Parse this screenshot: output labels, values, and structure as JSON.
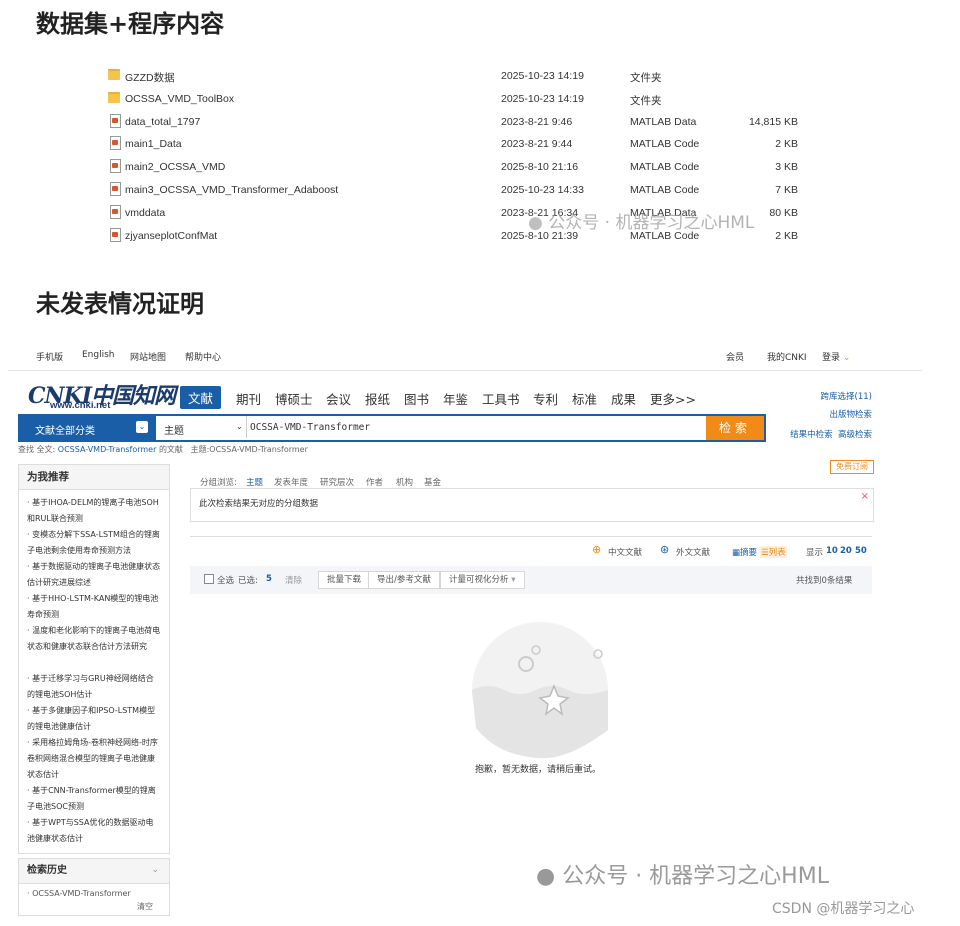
{
  "section1_title": "数据集+程序内容",
  "section2_title": "未发表情况证明",
  "files": [
    {
      "icon": "folder-icon",
      "name": "GZZD数据",
      "date": "2025-10-23 14:19",
      "type": "文件夹",
      "size": ""
    },
    {
      "icon": "folder-icon",
      "name": "OCSSA_VMD_ToolBox",
      "date": "2025-10-23 14:19",
      "type": "文件夹",
      "size": ""
    },
    {
      "icon": "matlab-file-icon",
      "name": "data_total_1797",
      "date": "2023-8-21 9:46",
      "type": "MATLAB Data",
      "size": "14,815 KB"
    },
    {
      "icon": "matlab-file-icon",
      "name": "main1_Data",
      "date": "2023-8-21 9:44",
      "type": "MATLAB Code",
      "size": "2 KB"
    },
    {
      "icon": "matlab-file-icon",
      "name": "main2_OCSSA_VMD",
      "date": "2025-8-10 21:16",
      "type": "MATLAB Code",
      "size": "3 KB"
    },
    {
      "icon": "matlab-file-icon",
      "name": "main3_OCSSA_VMD_Transformer_Adaboost",
      "date": "2025-10-23 14:33",
      "type": "MATLAB Code",
      "size": "7 KB"
    },
    {
      "icon": "matlab-file-icon",
      "name": "vmddata",
      "date": "2023-8-21 16:34",
      "type": "MATLAB Data",
      "size": "80 KB"
    },
    {
      "icon": "matlab-file-icon",
      "name": "zjyanseplotConfMat",
      "date": "2025-8-10 21:39",
      "type": "MATLAB Code",
      "size": "2 KB"
    }
  ],
  "watermark_small": "公众号 · 机器学习之心HML",
  "cnki": {
    "topbar": {
      "mobile": "手机版",
      "english": "English",
      "sitemap": "网站地图",
      "help": "帮助中心",
      "member": "会员",
      "my_cnki": "我的CNKI",
      "login": "登录"
    },
    "logo_text": "CNKI中国知网",
    "logo_url": "www.cnki.net",
    "nav": [
      "文献",
      "期刊",
      "博硕士",
      "会议",
      "报纸",
      "图书",
      "年鉴",
      "工具书",
      "专利",
      "标准",
      "成果",
      "更多>>"
    ],
    "side_links": {
      "cross_db": "跨库选择(11)",
      "publication_search": "出版物检索",
      "search_in_results": "结果中检索",
      "advanced_search": "高级检索"
    },
    "search": {
      "category": "文献全部分类",
      "field": "主题",
      "query": "OCSSA-VMD-Transformer",
      "button": "检索"
    },
    "crumb": {
      "prefix": "查找 全文:",
      "query": "OCSSA-VMD-Transformer",
      "suffix": "的文献",
      "subject": "主题:OCSSA-VMD-Transformer"
    },
    "free_subscribe": "免费订阅",
    "recommend_title": "为我推荐",
    "recommend": [
      "基于IHOA-DELM的锂离子电池SOH和RUL联合预测",
      "变模态分解下SSA-LSTM组合的锂离子电池剩余使用寿命预测方法",
      "基于数据驱动的锂离子电池健康状态估计研究进展综述",
      "基于HHO-LSTM-KAN模型的锂电池寿命预测",
      "温度和老化影响下的锂离子电池荷电状态和健康状态联合估计方法研究",
      "基于迁移学习与GRU神经网络结合的锂电池SOH估计",
      "基于多健康因子和IPSO-LSTM模型的锂电池健康估计",
      "采用格拉姆角场-卷积神经网络-时序卷积网络混合模型的锂离子电池健康状态估计",
      "基于CNN-Transformer模型的锂离子电池SOC预测",
      "基于WPT与SSA优化的数据驱动电池健康状态估计"
    ],
    "history_title": "检索历史",
    "history_item": "OCSSA-VMD-Transformer",
    "history_clear": "清空",
    "group_tabs": {
      "label": "分组浏览:",
      "items": [
        "主题",
        "发表年度",
        "研究层次",
        "作者",
        "机构",
        "基金"
      ]
    },
    "group_msg": "此次检索结果无对应的分组数据",
    "lang": {
      "chinese": "中文文献",
      "foreign": "外文文献",
      "abstract": "摘要",
      "list": "列表",
      "show_label": "显示",
      "sizes": [
        "10",
        "20",
        "50"
      ]
    },
    "toolbar": {
      "select_all": "全选",
      "selected_label": "已选:",
      "selected_count": "5",
      "clear": "清除",
      "batch_download": "批量下载",
      "export": "导出/参考文献",
      "visualize": "计量可视化分析",
      "total": "共找到0条结果"
    },
    "empty_msg": "抱歉，暂无数据，请稍后重试。"
  },
  "watermark_large": "公众号 · 机器学习之心HML",
  "csdn_mark": "CSDN @机器学习之心",
  "colors": {
    "cnki_blue": "#1a5ea8",
    "search_orange": "#f08b18",
    "folder_yellow": "#f4c548"
  }
}
